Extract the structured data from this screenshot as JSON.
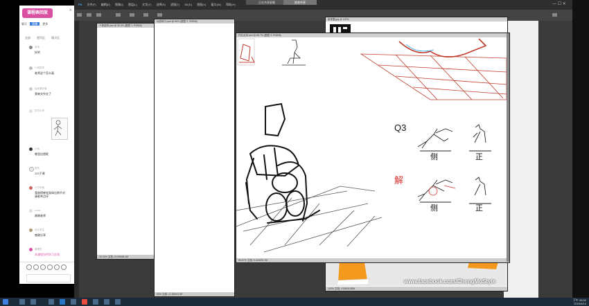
{
  "chat": {
    "logo": "课程表回放",
    "tabs": [
      "聊天",
      "直播",
      "更多"
    ],
    "subtabs": [
      "全部",
      "提问区",
      "聊天区"
    ],
    "messages": [
      {
        "name": "老师",
        "text": "好的"
      },
      {
        "name": "小明同学",
        "text": "老师这个怎么画"
      },
      {
        "name": "绘画爱好者",
        "text": "我来交作业了"
      },
      {
        "name": "学员小李",
        "text": ""
      },
      {
        "name": "小雨",
        "text": "哪里出错呢"
      },
      {
        "name": "阿杰",
        "text": "123下课"
      },
      {
        "name": "小白学画",
        "text": "我画得感觉身体比例不对",
        "text2": "请老师点评"
      },
      {
        "name": "Luna",
        "text": "谢谢老师"
      },
      {
        "name": "设计学生",
        "text": "感谢分享"
      },
      {
        "name": "管理员",
        "text": "本课程仅供学习交流"
      }
    ]
  },
  "ps": {
    "menu": [
      "PS",
      "文件(F)",
      "编辑(E)",
      "图像(I)",
      "图层(L)",
      "文字(Y)",
      "选择(S)",
      "滤镜(T)",
      "3D(D)",
      "视图(V)",
      "窗口(W)",
      "帮助(H)"
    ],
    "top_tab_1": "正在共享屏幕",
    "top_tab_2": "结束共享",
    "windows": {
      "back_left": {
        "title": "人体结构.psd @ 33.3% (图层 1, RGB/8)",
        "status": "33.33%    文档: 24.9M/68.1M"
      },
      "back_middle": {
        "title": "动态练习.psd @ 50% (图层 2, RGB/8)",
        "status": "50%    文档: 12.5M/40.2M"
      },
      "main": {
        "title": "作业点评.psd @ 66.7% (图层 3, RGB/8)",
        "status": "66.67%    文档: 8.44M/32.1M"
      },
      "photo": {
        "title": "参考图.jpg @ 100%",
        "status": "100%    文档: 4.55M/4.55M"
      }
    },
    "watermark": "www.facebook.com/ChengMoStyle",
    "annotations": {
      "q": "Q3",
      "side": "侧",
      "front": "正",
      "solution": "解"
    }
  },
  "taskbar": {
    "time": "下午 08:52",
    "date": "2020/6/14"
  }
}
